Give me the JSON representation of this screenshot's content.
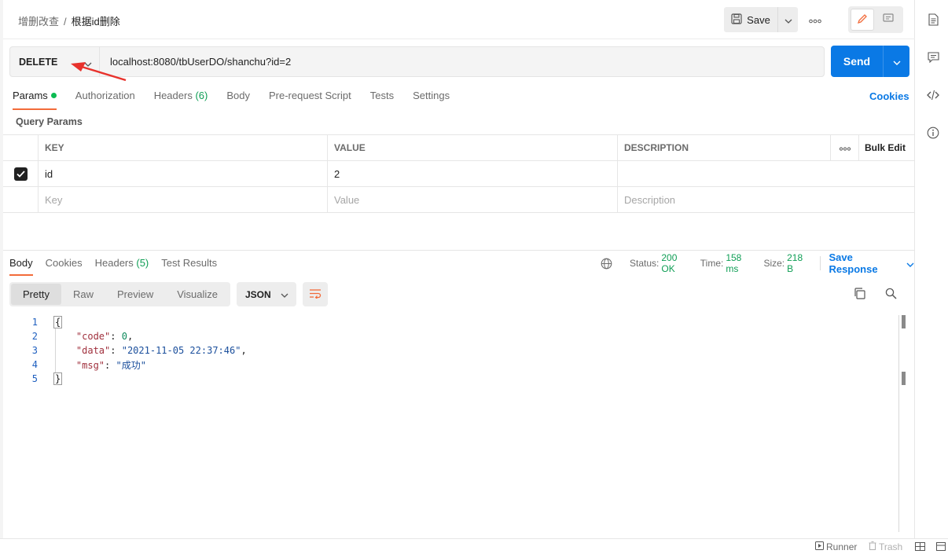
{
  "breadcrumb": {
    "parent": "增删改查",
    "separator": "/",
    "current": "根据id删除"
  },
  "header": {
    "save_label": "Save"
  },
  "request": {
    "method": "DELETE",
    "url": "localhost:8080/tbUserDO/shanchu?id=2",
    "send_label": "Send"
  },
  "request_tabs": {
    "params": "Params",
    "authorization": "Authorization",
    "headers": "Headers",
    "headers_count": "(6)",
    "body": "Body",
    "prerequest": "Pre-request Script",
    "tests": "Tests",
    "settings": "Settings",
    "cookies": "Cookies"
  },
  "query_params": {
    "title": "Query Params",
    "headers": {
      "key": "KEY",
      "value": "VALUE",
      "description": "DESCRIPTION",
      "more": "ooo",
      "bulk_edit": "Bulk Edit"
    },
    "rows": [
      {
        "checked": true,
        "key": "id",
        "value": "2",
        "description": ""
      }
    ],
    "placeholders": {
      "key": "Key",
      "value": "Value",
      "description": "Description"
    }
  },
  "response": {
    "tabs": {
      "body": "Body",
      "cookies": "Cookies",
      "headers": "Headers",
      "headers_count": "(5)",
      "test_results": "Test Results"
    },
    "status_label": "Status:",
    "status_value": "200 OK",
    "time_label": "Time:",
    "time_value": "158 ms",
    "size_label": "Size:",
    "size_value": "218 B",
    "save_response": "Save Response",
    "view_modes": [
      "Pretty",
      "Raw",
      "Preview",
      "Visualize"
    ],
    "format": "JSON",
    "line_numbers": [
      "1",
      "2",
      "3",
      "4",
      "5"
    ],
    "json": {
      "open_brace": "{",
      "code_key": "\"code\"",
      "code_val": "0",
      "data_key": "\"data\"",
      "data_val": "\"2021-11-05 22:37:46\"",
      "msg_key": "\"msg\"",
      "msg_val": "\"成功\"",
      "close_brace": "}"
    }
  },
  "footer": {
    "runner": "Runner",
    "trash": "Trash"
  },
  "colors": {
    "accent_orange": "#f26b3a",
    "send_blue": "#0a79e5",
    "status_green": "#0f9e55",
    "annotation_red": "#e8322c"
  }
}
